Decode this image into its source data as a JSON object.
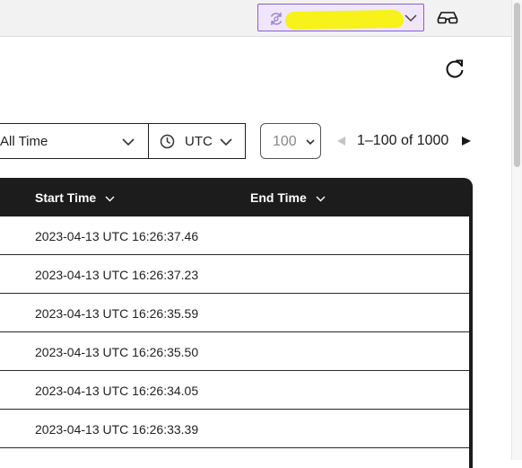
{
  "header": {
    "account_name": "",
    "icons": [
      "sync-icon",
      "chevron-down-icon",
      "glasses-icon"
    ]
  },
  "toolbar": {
    "refresh_icon": "refresh-icon"
  },
  "filters": {
    "time_range": "All Time",
    "timezone": "UTC",
    "page_size": "100"
  },
  "pagination": {
    "range": "1–100 of 1000"
  },
  "table": {
    "columns": [
      {
        "label": "Start Time"
      },
      {
        "label": "End Time"
      }
    ],
    "rows": [
      {
        "start": "2023-04-13 UTC 16:26:37.46",
        "end": ""
      },
      {
        "start": "2023-04-13 UTC 16:26:37.23",
        "end": ""
      },
      {
        "start": "2023-04-13 UTC 16:26:35.59",
        "end": ""
      },
      {
        "start": "2023-04-13 UTC 16:26:35.50",
        "end": ""
      },
      {
        "start": "2023-04-13 UTC 16:26:34.05",
        "end": ""
      },
      {
        "start": "2023-04-13 UTC 16:26:33.39",
        "end": ""
      },
      {
        "start": "",
        "end": ""
      }
    ]
  },
  "colors": {
    "accent_purple": "#8a5ad6",
    "redaction_yellow": "#f6f21a",
    "header_dark": "#1c1c1c"
  }
}
